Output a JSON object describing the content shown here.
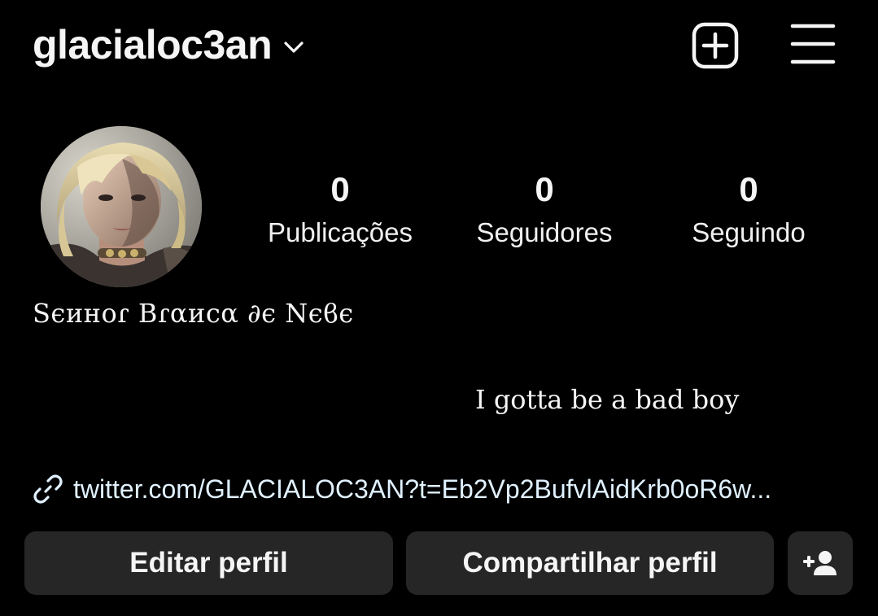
{
  "header": {
    "username": "glacialoc3an",
    "account_switch_icon": "chevron-down-icon",
    "new_post_icon": "plus-square-icon",
    "menu_icon": "hamburger-menu-icon"
  },
  "profile": {
    "avatar_icon": "profile-avatar-photo",
    "display_name": "Ѕєинoɾ Bɾαиcα ∂є Nєϐє",
    "bio": "I gotta be a bad boy",
    "link_icon": "link-icon",
    "link": "twitter.com/GLACIALOC3AN?t=Eb2Vp2BufvlAidKrb0oR6w..."
  },
  "stats": [
    {
      "value": "0",
      "label": "Publicações"
    },
    {
      "value": "0",
      "label": "Seguidores"
    },
    {
      "value": "0",
      "label": "Seguindo"
    }
  ],
  "actions": {
    "edit_label": "Editar perfil",
    "share_label": "Compartilhar perfil",
    "add_icon": "person-add-icon"
  },
  "colors": {
    "background": "#000000",
    "text": "#f5f5f5",
    "button_bg": "#262626",
    "link_text": "#e0f1ff"
  }
}
